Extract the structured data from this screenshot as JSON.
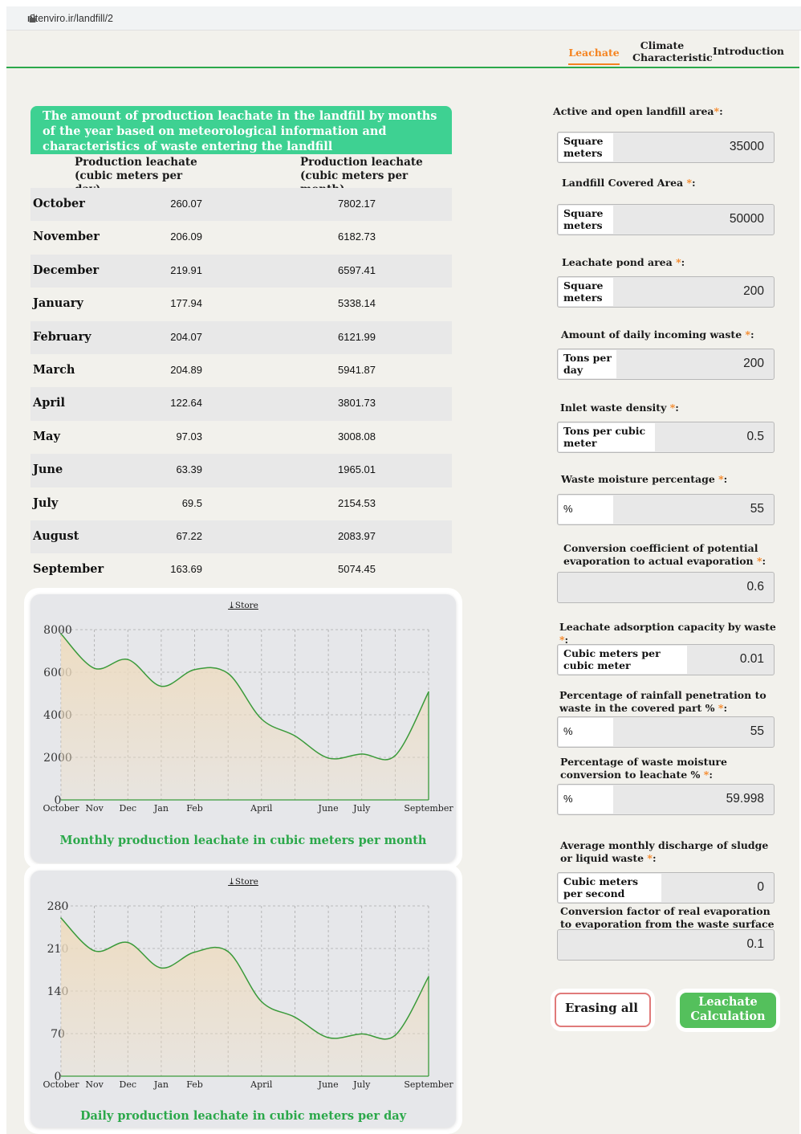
{
  "url": "nitenviro.ir/landfill/2",
  "nav": {
    "tabs": [
      "Leachate",
      "Climate Characteristic",
      "Introduction"
    ],
    "active_tab": "Leachate"
  },
  "table": {
    "title": "The amount of production leachate in the landfill by months of the year based on meteorological information and characteristics of waste entering the landfill",
    "col1_header": "Production leachate (cubic meters per day)",
    "col2_header": "Production leachate (cubic meters per month)",
    "rows": [
      {
        "month": "October",
        "day": "260.07",
        "month_total": "7802.17"
      },
      {
        "month": "November",
        "day": "206.09",
        "month_total": "6182.73"
      },
      {
        "month": "December",
        "day": "219.91",
        "month_total": "6597.41"
      },
      {
        "month": "January",
        "day": "177.94",
        "month_total": "5338.14"
      },
      {
        "month": "February",
        "day": "204.07",
        "month_total": "6121.99"
      },
      {
        "month": "March",
        "day": "204.89",
        "month_total": "5941.87"
      },
      {
        "month": "April",
        "day": "122.64",
        "month_total": "3801.73"
      },
      {
        "month": "May",
        "day": "97.03",
        "month_total": "3008.08"
      },
      {
        "month": "June",
        "day": "63.39",
        "month_total": "1965.01"
      },
      {
        "month": "July",
        "day": "69.5",
        "month_total": "2154.53"
      },
      {
        "month": "August",
        "day": "67.22",
        "month_total": "2083.97"
      },
      {
        "month": "September",
        "day": "163.69",
        "month_total": "5074.45"
      }
    ]
  },
  "store_label": "Store",
  "chart_data": [
    {
      "type": "area",
      "title": "Monthly production leachate in cubic meters per month",
      "x": [
        "October",
        "Nov",
        "Dec",
        "Jan",
        "Feb",
        "March",
        "April",
        "May",
        "June",
        "July",
        "August",
        "September"
      ],
      "x_tick_labels": [
        "October",
        "Nov",
        "Dec",
        "Jan",
        "Feb",
        "April",
        "June",
        "July",
        "September"
      ],
      "y": [
        7802.17,
        6182.73,
        6597.41,
        5338.14,
        6121.99,
        5941.87,
        3801.73,
        3008.08,
        1965.01,
        2154.53,
        2083.97,
        5074.45
      ],
      "yticks": [
        "0",
        "2000",
        "4000",
        "6000",
        "8000"
      ],
      "ylim": [
        0,
        8000
      ],
      "grid": true,
      "line_color": "#3a9a3a",
      "fill_color": "#eedcc0"
    },
    {
      "type": "area",
      "title": "Daily production leachate in cubic meters per day",
      "x": [
        "October",
        "Nov",
        "Dec",
        "Jan",
        "Feb",
        "March",
        "April",
        "May",
        "June",
        "July",
        "August",
        "September"
      ],
      "x_tick_labels": [
        "October",
        "Nov",
        "Dec",
        "Jan",
        "Feb",
        "April",
        "June",
        "July",
        "September"
      ],
      "y": [
        260.07,
        206.09,
        219.91,
        177.94,
        204.07,
        204.89,
        122.64,
        97.03,
        63.39,
        69.5,
        67.22,
        163.69
      ],
      "yticks": [
        "0",
        "70",
        "140",
        "210",
        "280"
      ],
      "ylim": [
        0,
        280
      ],
      "grid": true,
      "line_color": "#3a9a3a",
      "fill_color": "#eedcc0"
    }
  ],
  "form": {
    "fields": [
      {
        "label": "Active and open landfill area",
        "unit": "Square meters",
        "value": "35000"
      },
      {
        "label": "Landfill Covered Area ",
        "unit": "Square meters",
        "value": "50000"
      },
      {
        "label": "Leachate pond area ",
        "unit": "Square meters",
        "value": "200"
      },
      {
        "label": "Amount of daily incoming waste ",
        "unit": "Tons per day",
        "value": "200"
      },
      {
        "label": "Inlet waste density ",
        "unit": "Tons per cubic meter",
        "value": "0.5"
      },
      {
        "label": "Waste moisture percentage ",
        "unit": "%",
        "value": "55"
      },
      {
        "label": "Conversion coefficient of potential evaporation to actual evaporation ",
        "unit": "",
        "value": "0.6"
      },
      {
        "label": "Leachate adsorption capacity by waste ",
        "unit": "Cubic meters per cubic meter",
        "value": "0.01"
      },
      {
        "label": "Percentage of rainfall penetration to waste in the covered part % ",
        "unit": "%",
        "value": "55"
      },
      {
        "label": "Percentage of waste moisture conversion to leachate % ",
        "unit": "%",
        "value": "59.998"
      },
      {
        "label": "Average monthly discharge of sludge or liquid waste ",
        "unit": "Cubic meters per second",
        "value": "0"
      },
      {
        "label": "Conversion factor of real evaporation to evaporation from the waste surface ",
        "unit": "",
        "value": "0.1"
      }
    ],
    "erase_label": "Erasing all",
    "calc_label": "Leachate Calculation"
  },
  "colors": {
    "accent_orange": "#f5831f",
    "brand_green": "#2ba84a",
    "table_header": "#3ed192",
    "button_green": "#54c05c"
  },
  "icons": [
    "lock-icon",
    "download-icon"
  ]
}
